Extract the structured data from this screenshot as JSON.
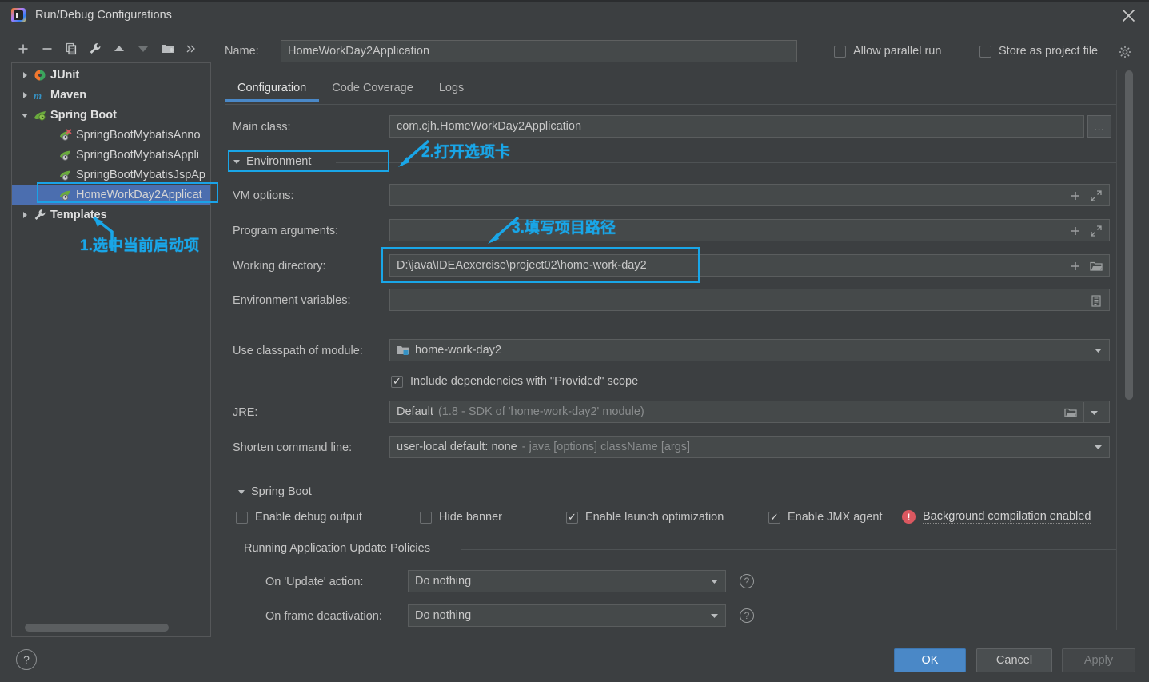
{
  "window": {
    "title": "Run/Debug Configurations",
    "app_icon": "intellij-idea-icon",
    "close_icon": "close-icon"
  },
  "left_panel": {
    "toolbar": [
      {
        "name": "add-configuration-button",
        "icon": "plus-icon"
      },
      {
        "name": "remove-configuration-button",
        "icon": "minus-icon"
      },
      {
        "name": "copy-configuration-button",
        "icon": "copy-icon"
      },
      {
        "name": "edit-templates-button",
        "icon": "wrench-icon"
      },
      {
        "name": "move-up-button",
        "icon": "arrow-up-icon"
      },
      {
        "name": "move-down-button",
        "icon": "arrow-down-icon"
      },
      {
        "name": "create-folder-button",
        "icon": "folder-add-icon"
      },
      {
        "name": "more-options-button",
        "icon": "chevron-double-right-icon"
      }
    ],
    "tree": [
      {
        "label": "JUnit",
        "depth": 0,
        "twisty": "collapsed",
        "icon": "junit-icon",
        "bold": true,
        "selected": false
      },
      {
        "label": "Maven",
        "depth": 0,
        "twisty": "collapsed",
        "icon": "maven-icon",
        "bold": true,
        "selected": false
      },
      {
        "label": "Spring Boot",
        "depth": 0,
        "twisty": "expanded",
        "icon": "spring-boot-icon",
        "bold": true,
        "selected": false
      },
      {
        "label": "SpringBootMybatisAnno",
        "depth": 1,
        "twisty": "none",
        "icon": "spring-run-config-icon",
        "bold": false,
        "selected": false
      },
      {
        "label": "SpringBootMybatisAppli",
        "depth": 1,
        "twisty": "none",
        "icon": "spring-run-config-icon",
        "bold": false,
        "selected": false
      },
      {
        "label": "SpringBootMybatisJspAp",
        "depth": 1,
        "twisty": "none",
        "icon": "spring-run-config-icon",
        "bold": false,
        "selected": false
      },
      {
        "label": "HomeWorkDay2Applicat",
        "depth": 1,
        "twisty": "none",
        "icon": "spring-run-config-icon",
        "bold": false,
        "selected": true
      },
      {
        "label": "Templates",
        "depth": 0,
        "twisty": "collapsed",
        "icon": "wrench-icon",
        "bold": true,
        "selected": false
      }
    ]
  },
  "header": {
    "name_label": "Name:",
    "name_value": "HomeWorkDay2Application",
    "allow_parallel_run": {
      "label": "Allow parallel run",
      "checked": false
    },
    "store_as_project_file": {
      "label": "Store as project file",
      "checked": false
    },
    "gear_icon": "gear-icon"
  },
  "tabs": [
    {
      "label": "Configuration",
      "active": true
    },
    {
      "label": "Code Coverage",
      "active": false
    },
    {
      "label": "Logs",
      "active": false
    }
  ],
  "configuration": {
    "main_class": {
      "label": "Main class:",
      "value": "com.cjh.HomeWorkDay2Application",
      "browse_label": "..."
    },
    "environment_section": {
      "label": "Environment",
      "expanded": true
    },
    "vm_options": {
      "label": "VM options:",
      "value": "",
      "icons": [
        "plus-icon",
        "expand-icon"
      ]
    },
    "program_arguments": {
      "label": "Program arguments:",
      "value": "",
      "icons": [
        "plus-icon",
        "expand-icon"
      ]
    },
    "working_directory": {
      "label": "Working directory:",
      "value": "D:\\java\\IDEAexercise\\project02\\home-work-day2",
      "icons": [
        "plus-icon",
        "folder-icon"
      ]
    },
    "environment_variables": {
      "label": "Environment variables:",
      "value": "",
      "icons": [
        "list-icon"
      ]
    },
    "use_classpath_of_module": {
      "label": "Use classpath of module:",
      "value": "home-work-day2",
      "icon": "module-icon"
    },
    "include_provided_scope": {
      "label": "Include dependencies with \"Provided\" scope",
      "checked": true
    },
    "jre": {
      "label": "JRE:",
      "value": "Default",
      "value_hint": "(1.8 - SDK of 'home-work-day2' module)",
      "icons": [
        "folder-icon",
        "chevron-down-icon"
      ]
    },
    "shorten_command_line": {
      "label": "Shorten command line:",
      "value": "user-local default: none",
      "value_hint": "- java [options] className [args]"
    }
  },
  "spring_boot": {
    "section_label": "Spring Boot",
    "checkboxes": [
      {
        "label": "Enable debug output",
        "checked": false
      },
      {
        "label": "Hide banner",
        "checked": false
      },
      {
        "label": "Enable launch optimization",
        "checked": true
      },
      {
        "label": "Enable JMX agent",
        "checked": true
      }
    ],
    "warning": {
      "icon": "error-icon",
      "text": "Background compilation enabled"
    },
    "update_policies": {
      "section_label": "Running Application Update Policies",
      "rows": [
        {
          "label": "On 'Update' action:",
          "value": "Do nothing",
          "help_icon": "help-icon"
        },
        {
          "label": "On frame deactivation:",
          "value": "Do nothing",
          "help_icon": "help-icon"
        }
      ]
    }
  },
  "footer": {
    "help_label": "?",
    "ok_label": "OK",
    "cancel_label": "Cancel",
    "apply_label": "Apply"
  },
  "annotations": [
    {
      "id": "a1",
      "text": "1.选中当前启动项"
    },
    {
      "id": "a2",
      "text": "2.打开选项卡"
    },
    {
      "id": "a3",
      "text": "3.填写项目路径"
    }
  ],
  "colors": {
    "window_bg": "#3c3f41",
    "field_bg": "#45494a",
    "accent_blue": "#4a88c7",
    "selection_blue": "#4b6eaf",
    "annotation_cyan": "#19a6e8",
    "error_red": "#db5860"
  }
}
